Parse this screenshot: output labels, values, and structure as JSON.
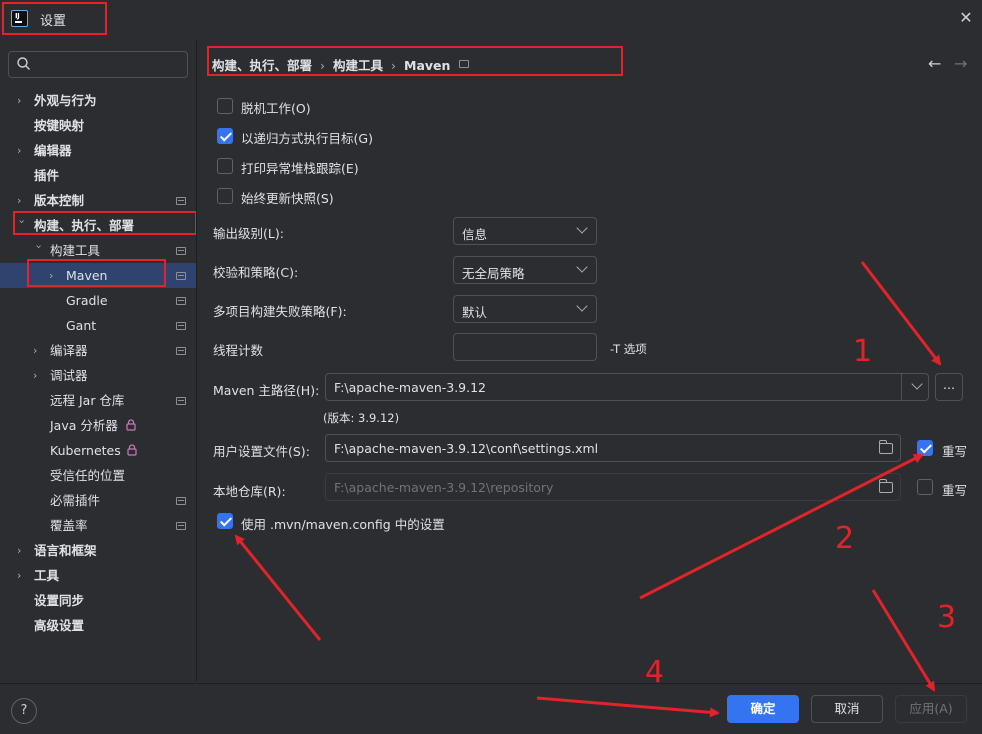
{
  "window": {
    "title": "设置"
  },
  "search": {
    "placeholder": ""
  },
  "sidebar": {
    "items": [
      {
        "label": "外观与行为"
      },
      {
        "label": "按键映射"
      },
      {
        "label": "编辑器"
      },
      {
        "label": "插件"
      },
      {
        "label": "版本控制"
      },
      {
        "label": "构建、执行、部署"
      },
      {
        "label": "构建工具"
      },
      {
        "label": "Maven"
      },
      {
        "label": "Gradle"
      },
      {
        "label": "Gant"
      },
      {
        "label": "编译器"
      },
      {
        "label": "调试器"
      },
      {
        "label": "远程 Jar 仓库"
      },
      {
        "label": "Java 分析器"
      },
      {
        "label": "Kubernetes"
      },
      {
        "label": "受信任的位置"
      },
      {
        "label": "必需插件"
      },
      {
        "label": "覆盖率"
      },
      {
        "label": "语言和框架"
      },
      {
        "label": "工具"
      },
      {
        "label": "设置同步"
      },
      {
        "label": "高级设置"
      }
    ]
  },
  "breadcrumb": {
    "part1": "构建、执行、部署",
    "part2": "构建工具",
    "part3": "Maven",
    "sep": "›"
  },
  "options": {
    "offline": {
      "label": "脱机工作(O)",
      "checked": false
    },
    "recursive": {
      "label": "以递归方式执行目标(G)",
      "checked": true
    },
    "stacktrace": {
      "label": "打印异常堆栈跟踪(E)",
      "checked": false
    },
    "update_snapshots": {
      "label": "始终更新快照(S)",
      "checked": false
    }
  },
  "form": {
    "output_level": {
      "label": "输出级别(L):",
      "value": "信息"
    },
    "checksum": {
      "label": "校验和策略(C):",
      "value": "无全局策略"
    },
    "multiproject_fail": {
      "label": "多项目构建失败策略(F):",
      "value": "默认"
    },
    "threads": {
      "label": "线程计数",
      "value": "",
      "suffix": "-T 选项"
    },
    "maven_home": {
      "label": "Maven 主路径(H):",
      "value": "F:\\apache-maven-3.9.12",
      "browse": "...",
      "version": "(版本: 3.9.12)"
    },
    "user_settings": {
      "label": "用户设置文件(S):",
      "value": "F:\\apache-maven-3.9.12\\conf\\settings.xml",
      "override_label": "重写",
      "override": true
    },
    "local_repo": {
      "label": "本地仓库(R):",
      "value": "F:\\apache-maven-3.9.12\\repository",
      "override_label": "重写",
      "override": false
    },
    "mvn_config": {
      "label": "使用 .mvn/maven.config 中的设置",
      "checked": true
    }
  },
  "buttons": {
    "ok": "确定",
    "cancel": "取消",
    "apply": "应用(A)",
    "help": "?"
  },
  "annotations": {
    "n1": "1",
    "n2": "2",
    "n3": "3",
    "n4": "4",
    "color": "#e2232a"
  }
}
